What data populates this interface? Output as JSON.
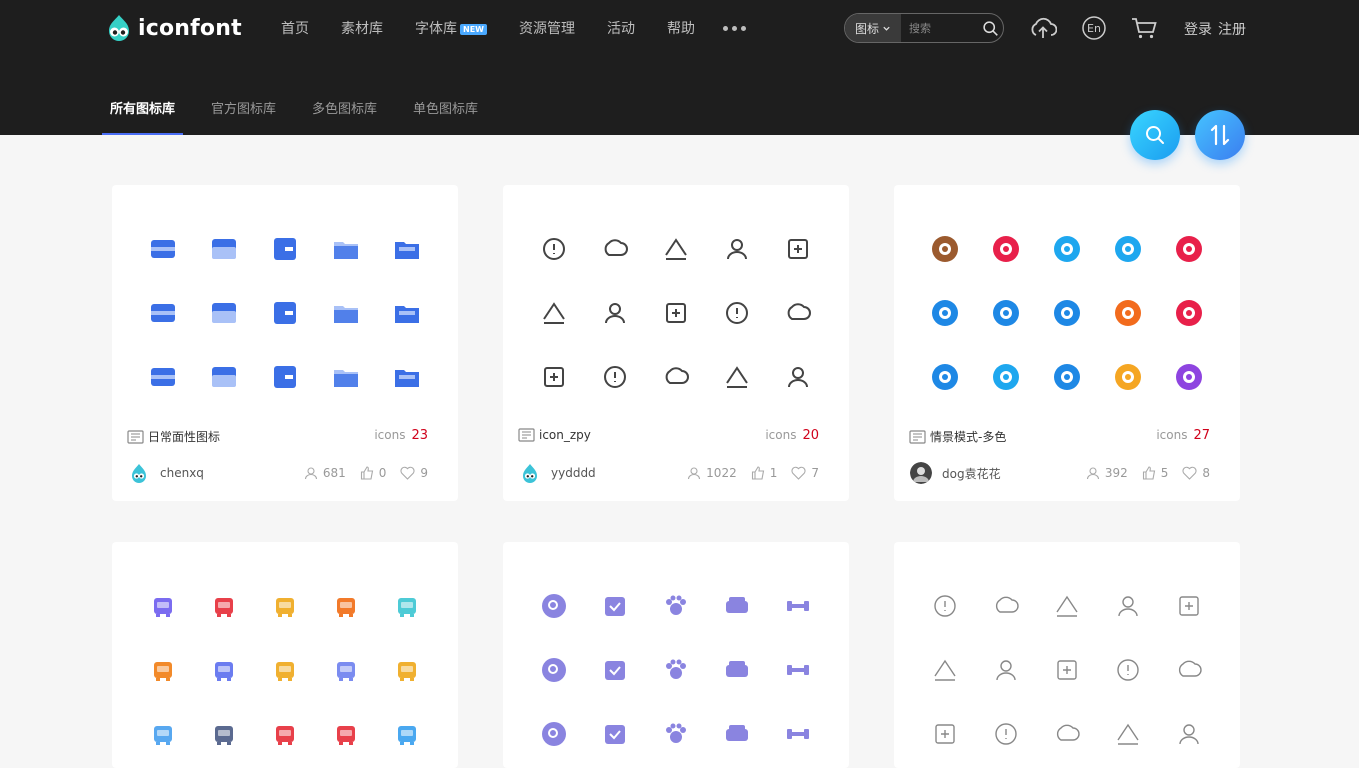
{
  "header": {
    "logo_text": "iconfont",
    "nav": [
      {
        "label": "首页"
      },
      {
        "label": "素材库"
      },
      {
        "label": "字体库",
        "badge": "NEW"
      },
      {
        "label": "资源管理"
      },
      {
        "label": "活动"
      },
      {
        "label": "帮助"
      }
    ],
    "search": {
      "type_label": "图标",
      "placeholder": "搜索"
    },
    "login_label": "登录",
    "register_label": "注册",
    "lang_label": "En"
  },
  "subnav": {
    "tabs": [
      {
        "label": "所有图标库",
        "active": true
      },
      {
        "label": "官方图标库"
      },
      {
        "label": "多色图标库"
      },
      {
        "label": "单色图标库"
      }
    ]
  },
  "cards": [
    {
      "title": "日常面性图标",
      "icons_label": "icons",
      "count": "23",
      "author": "chenxq",
      "followers": "681",
      "likes": "0",
      "favorites": "9",
      "style": "blue-fill",
      "icons": [
        "card-icon",
        "card-undo-icon",
        "card-export-icon",
        "folder-open-icon",
        "folder-add-icon",
        "folder-star-icon",
        "download-box-icon",
        "folder-list-icon",
        "bookmark-file-icon",
        "inbox-icon",
        "music-file-icon",
        "video-file-icon",
        "copy-add-icon",
        "document-copy-icon",
        "zip-file-icon"
      ]
    },
    {
      "title": "icon_zpy",
      "icons_label": "icons",
      "count": "20",
      "author": "yydddd",
      "followers": "1022",
      "likes": "1",
      "favorites": "7",
      "style": "line-dark",
      "icons": [
        "code-alert-icon",
        "upload-circle-icon",
        "login-icon",
        "upload-icon",
        "edit-tag-icon",
        "repeat-icon",
        "sync-icon",
        "logout-icon",
        "gear-icon",
        "download-icon",
        "help-icon",
        "text-list-icon",
        "document-search-icon",
        "folder-plus-icon",
        "folder-settings-icon"
      ]
    },
    {
      "title": "情景模式-多色",
      "icons_label": "icons",
      "count": "27",
      "author": "dog袁花花",
      "followers": "392",
      "likes": "5",
      "favorites": "8",
      "style": "multicolor-circle",
      "icons": [
        "meal-icon",
        "car-icon",
        "drive-icon",
        "camera-icon",
        "dish-icon",
        "sleep-icon",
        "power-icon",
        "airplane-icon",
        "power-off-icon",
        "home-icon",
        "moon-icon",
        "home-water-icon",
        "hand-icon",
        "group-icon",
        "dining-icon"
      ]
    },
    {
      "title": "",
      "style": "furniture-color",
      "icons": [
        "chair-icon",
        "lamp-icon",
        "vacuum-icon",
        "washer-icon",
        "basket-icon",
        "tv-icon",
        "printer-icon",
        "radio-icon",
        "fan-icon",
        "boat-icon",
        "fridge-icon",
        "kettle-icon",
        "camera-icon",
        "desk-lamp-icon",
        "iron-icon"
      ]
    },
    {
      "title": "",
      "style": "purple-fill",
      "icons": [
        "search-icon",
        "calendar-icon",
        "paw-icon",
        "sofa-icon",
        "dumbbell-icon",
        "dining-icon",
        "fridge-icon",
        "dish-cover-icon",
        "car-icon",
        "image-icon",
        "film-icon",
        "bag-icon",
        "building-icon",
        "medal-icon",
        "cocktail-icon"
      ]
    },
    {
      "title": "",
      "style": "line-gray",
      "icons": [
        "home-icon",
        "planet-icon",
        "camera-icon",
        "bell-icon",
        "user-icon",
        "tshirt-icon",
        "briefcase-icon",
        "heart-icon",
        "bookmark-star-icon",
        "gear-icon",
        "house-icon",
        "globe-icon",
        "airplane-icon",
        "wallet-icon",
        "person-icon"
      ]
    }
  ],
  "colors": {
    "header_bg": "#1e1e1e",
    "accent": "#4a6ef5",
    "count_red": "#d0021b",
    "blue_icon": "#3b6fe6",
    "purple_icon": "#8a84e0"
  }
}
